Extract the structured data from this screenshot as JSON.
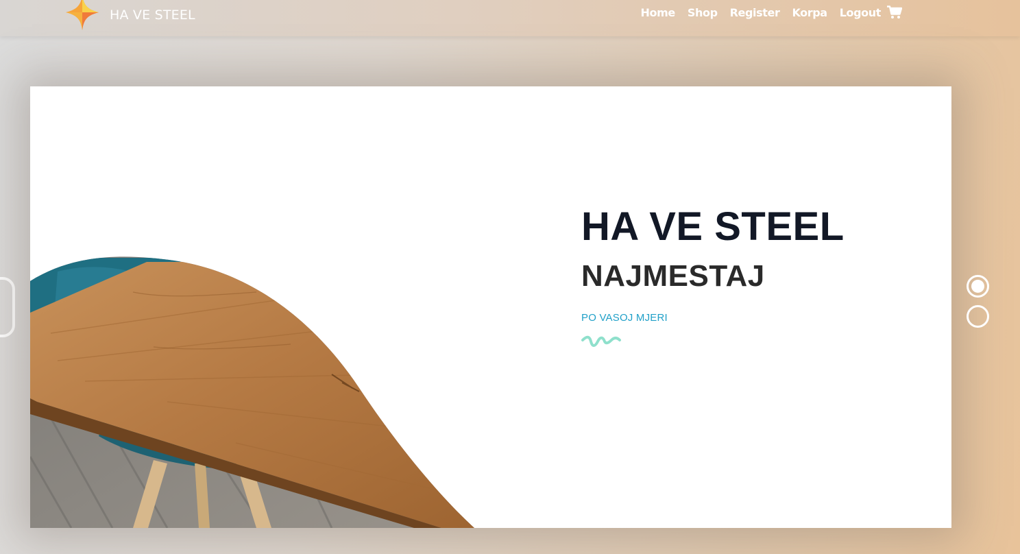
{
  "brand": {
    "name": "HA VE STEEL",
    "logo_icon": "star-logo-icon"
  },
  "nav": {
    "items": [
      {
        "label": "Home"
      },
      {
        "label": "Shop"
      },
      {
        "label": "Register"
      },
      {
        "label": "Korpa"
      },
      {
        "label": "Logout"
      }
    ],
    "cart_icon": "cart-icon"
  },
  "hero": {
    "title": "HA VE STEEL",
    "subtitle": "NAJMESTAJ",
    "tagline": "PO VASOJ MJERI",
    "decoration_icon": "squiggle-icon"
  },
  "slider": {
    "slide_count": 2,
    "active_slide": 1
  },
  "colors": {
    "tagline": "#20a0c8",
    "title": "#121826",
    "squiggle": "#8fe0cc",
    "nav_text": "#ffffff"
  }
}
